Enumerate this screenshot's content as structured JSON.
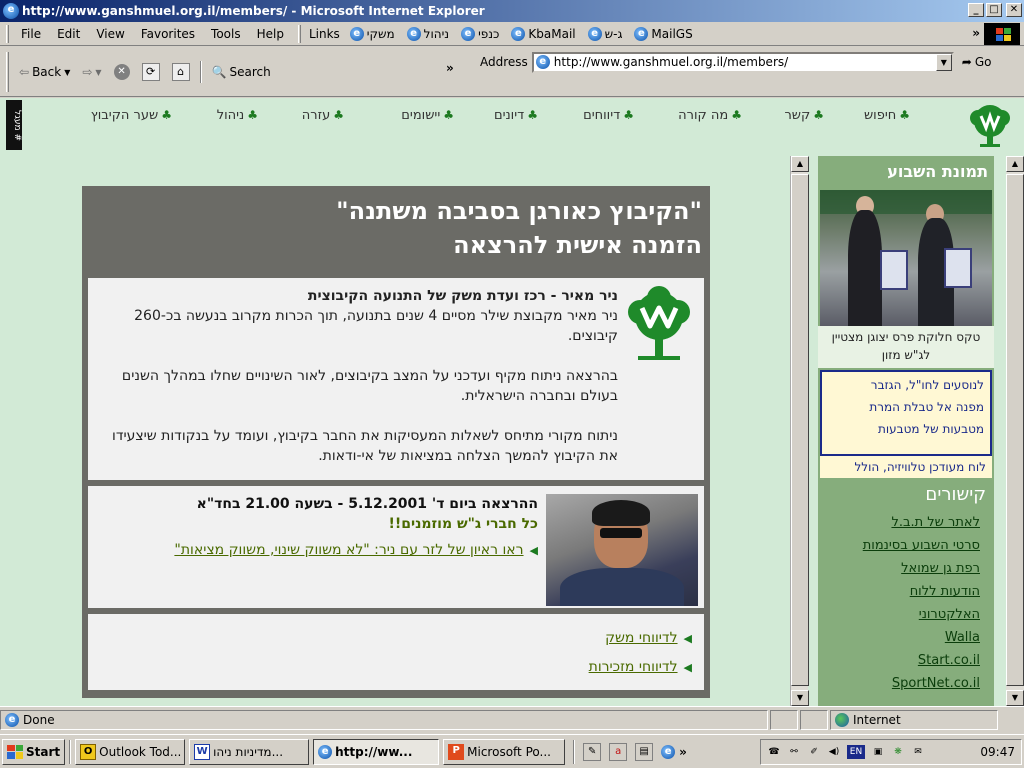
{
  "window": {
    "title": "http://www.ganshmuel.org.il/members/ - Microsoft Internet Explorer",
    "btn_min": "_",
    "btn_max": "□",
    "btn_close": "✕"
  },
  "menubar": {
    "items": [
      "File",
      "Edit",
      "View",
      "Favorites",
      "Tools",
      "Help"
    ],
    "links_label": "Links",
    "links": [
      "משקי",
      "ניהול",
      "כנפי",
      "KbaMail",
      "ג-ש",
      "MailGS"
    ],
    "overflow": "»"
  },
  "toolbar": {
    "back": "Back",
    "search": "Search",
    "overflow": "»",
    "address_label": "Address",
    "address_value": "http://www.ganshmuel.org.il/members/",
    "go": "Go"
  },
  "site_nav": {
    "side_tag": "מעגל #",
    "links": [
      "חיפוש",
      "קשר",
      "מה קורה",
      "דיווחים",
      "דיונים",
      "יישומים",
      "עזרה",
      "ניהול",
      "שער הקיבוץ"
    ]
  },
  "article": {
    "title_line1": "\"הקיבוץ כאורגן בסביבה משתנה\"",
    "title_line2": "הזמנה אישית להרצאה",
    "intro_head": "ניר מאיר - רכז ועדת משק של התנועה הקיבוצית",
    "intro_body": "ניר מאיר מקבוצת שילר מסיים 4 שנים בתנועה, תוך הכרות מקרוב בנעשה בכ-260 קיבוצים.",
    "para2": "בהרצאה ניתוח מקיף ועדכני על המצב בקיבוצים, לאור השינויים שחלו במהלך השנים בעולם ובחברה הישראלית.",
    "para3": "ניתוח מקורי מתיחס לשאלות המעסיקות את החבר בקיבוץ, ועומד על בנקודות שיצעידו את הקיבוץ להמשך הצלחה במציאות של אי-ודאות.",
    "lecture_date": "ההרצאה ביום ד' 5.12.2001 - בשעה 21.00 בחד\"א",
    "invite": "כל חברי ג\"ש מוזמנים!!",
    "interview_link": "ראו ראיון של לזר עם ניר: \"לא משווק שינוי, משווק מציאות\"",
    "bottom_links": [
      "לדיווחי משק",
      "לדיווחי מזכירות"
    ]
  },
  "sidebar": {
    "photo_heading": "תמונת השבוע",
    "photo_caption": "טקס חלוקת פרס יצוגן מצטיין לג\"ש מזון",
    "news_lines": [
      "לנוסעים לחו\"ל, הגזבר",
      "מפנה אל טבלת המרת",
      "מטבעות של מטבעות"
    ],
    "news_strip": "לוח מעודכן טלוויזיה, הולל",
    "links_heading": "קישורים",
    "links": [
      "לאתר של ת.ב.ל",
      "סרטי השבוע בסינמות",
      "רפת גן שמואל",
      "הודעות ללוח",
      "האלקטרוני",
      "Walla",
      "Start.co.il",
      "SportNet.co.il"
    ]
  },
  "status": {
    "text": "Done",
    "zone": "Internet"
  },
  "taskbar": {
    "start": "Start",
    "tasks": [
      "Outlook Tod...",
      "מדיניות ניהו...",
      "http://ww...",
      "Microsoft Po..."
    ],
    "tray_lang": "EN",
    "clock": "09:47"
  },
  "colors": {
    "page_bg": "#d2ead6",
    "article_bg": "#6b6b66",
    "sidebar_bg": "#86ad7c",
    "link_green": "#4a6a00",
    "title_blue": "#0a246a"
  }
}
